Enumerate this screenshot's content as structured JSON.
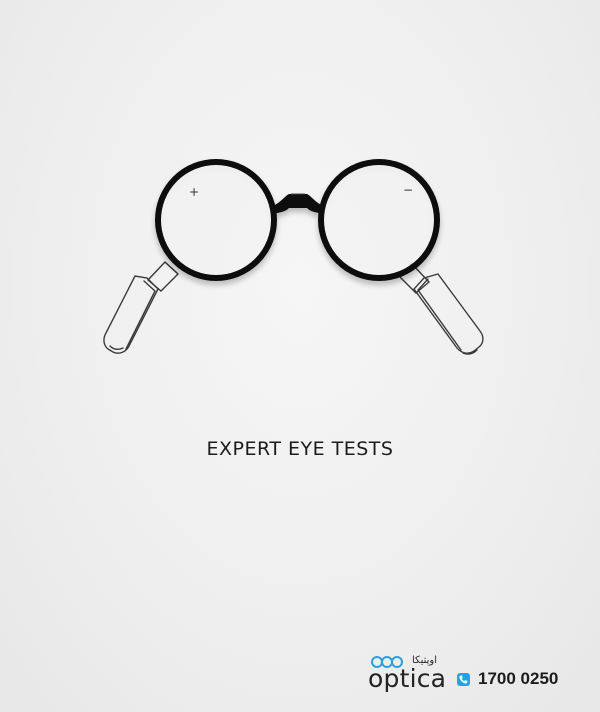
{
  "ad": {
    "headline": "EXPERT EYE TESTS",
    "lens_marks": {
      "left": "+",
      "right": "−"
    }
  },
  "brand": {
    "arabic_name": "اوپتيكا",
    "wordmark": "optica",
    "accent_color": "#2aa1dc",
    "mark_icon": "three-overlapping-rings-icon"
  },
  "contact": {
    "phone_icon": "phone-icon",
    "phone_number": "1700 0250"
  },
  "colors": {
    "background": "#eeeeee",
    "frame": "#111111",
    "sketch_line": "#3a3a3a"
  }
}
